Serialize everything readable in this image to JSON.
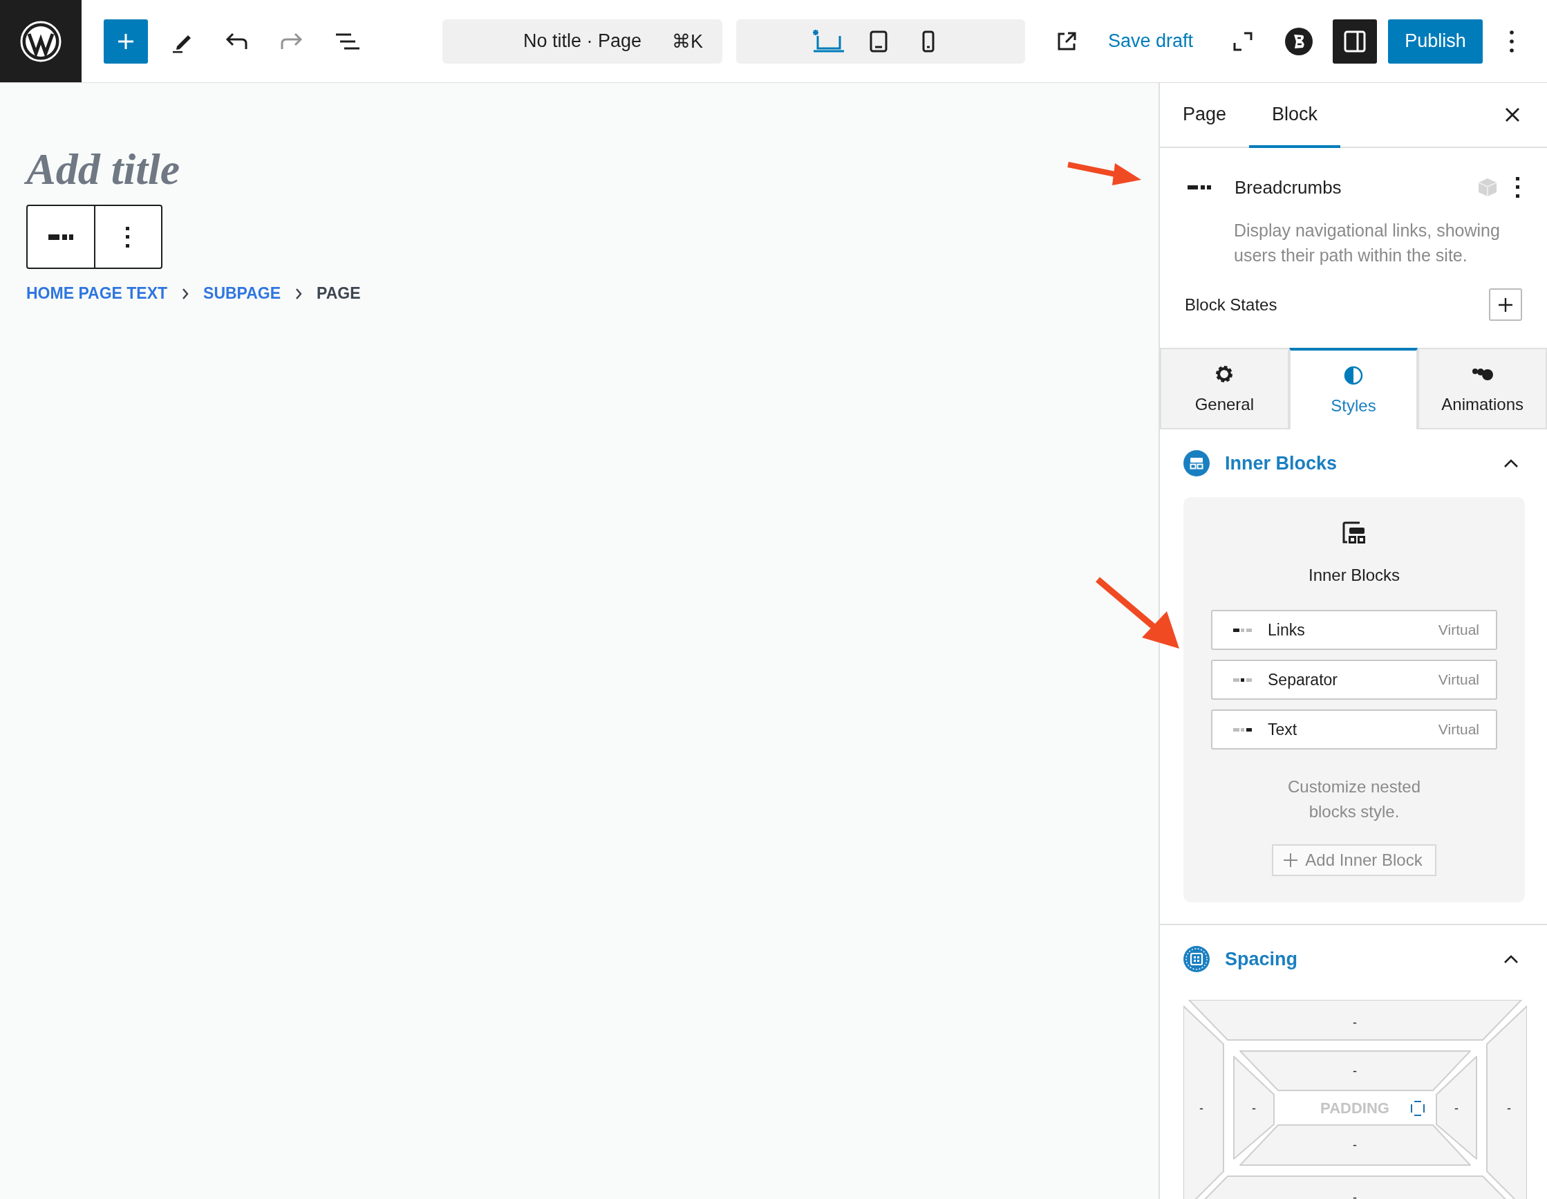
{
  "toolbar": {
    "undo": {
      "disabled": false
    },
    "redo": {
      "disabled": true
    },
    "document_title": "No title · Page",
    "shortcut": "⌘K",
    "devices": [
      {
        "kind": "desktop",
        "selected": true
      },
      {
        "kind": "tablet",
        "selected": false
      },
      {
        "kind": "mobile",
        "selected": false
      }
    ],
    "save_draft": "Save draft",
    "settings_open": true,
    "publish": "Publish"
  },
  "canvas": {
    "title_placeholder": "Add title",
    "breadcrumbs": [
      {
        "label": "HOME PAGE TEXT",
        "kind": "link"
      },
      {
        "label": "SUBPAGE",
        "kind": "link"
      },
      {
        "label": "PAGE",
        "kind": "current"
      }
    ]
  },
  "sidebar": {
    "tabs": [
      {
        "label": "Page",
        "selected": false
      },
      {
        "label": "Block",
        "selected": true
      }
    ],
    "block": {
      "name": "Breadcrumbs",
      "description": "Display navigational links, showing users their path within the site."
    },
    "block_states": "Block States",
    "style_tabs": [
      {
        "label": "General",
        "kind": "general",
        "selected": false
      },
      {
        "label": "Styles",
        "kind": "styles",
        "selected": true
      },
      {
        "label": "Animations",
        "kind": "animations",
        "selected": false
      }
    ],
    "inner_blocks": {
      "title": "Inner Blocks",
      "expanded": true,
      "heading": "Inner Blocks",
      "items": [
        {
          "label": "Links",
          "tag": "Virtual",
          "kind": "links"
        },
        {
          "label": "Separator",
          "tag": "Virtual",
          "kind": "separator"
        },
        {
          "label": "Text",
          "tag": "Virtual",
          "kind": "text"
        }
      ],
      "hint": "Customize nested blocks style.",
      "add_button": "Add Inner Block"
    },
    "spacing": {
      "title": "Spacing",
      "expanded": true,
      "center_label": "PADDING",
      "margin": {
        "top": "-",
        "right": "-",
        "bottom": "-",
        "left": "-"
      },
      "padding": {
        "top": "-",
        "right": "-",
        "bottom": "-",
        "left": "-"
      }
    }
  }
}
